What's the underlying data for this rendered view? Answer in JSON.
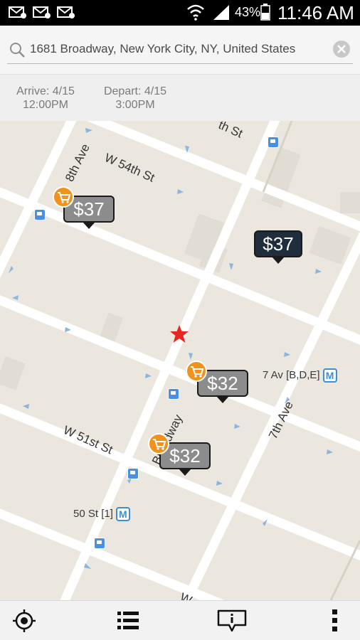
{
  "status_bar": {
    "battery_percent": "43%",
    "time": "11:46 AM",
    "icons": [
      "email-icon",
      "email-icon",
      "email-icon",
      "wifi-icon",
      "signal-icon",
      "battery-icon"
    ]
  },
  "search": {
    "value": "1681 Broadway, New York City, NY, United States",
    "icon": "search-icon",
    "clear_icon": "clear-icon"
  },
  "dates": {
    "arrive_label": "Arrive: 4/15",
    "arrive_time": "12:00PM",
    "depart_label": "Depart: 4/15",
    "depart_time": "3:00PM"
  },
  "map": {
    "streets": {
      "w54": "W 54th St",
      "w51": "W 51st St",
      "eighth": "8th Ave",
      "seventh": "7th Ave",
      "broadway": "Broadway",
      "top_partial": "th St",
      "bottom_partial": "W"
    },
    "stations": {
      "seventh_av": "7 Av [B,D,E]",
      "fifty_st": "50 St [1]",
      "badge": "M"
    },
    "pins": [
      {
        "price": "$37",
        "style": "gray",
        "has_cart": true
      },
      {
        "price": "$37",
        "style": "dark",
        "has_cart": false
      },
      {
        "price": "$32",
        "style": "gray",
        "has_cart": true
      },
      {
        "price": "$32",
        "style": "gray",
        "has_cart": true
      }
    ],
    "destination_icon": "star-icon",
    "colors": {
      "land": "#ebe7df",
      "road": "#ffffff",
      "pin_gray": "#8c8c8c",
      "pin_dark": "#1f2d3d",
      "cart": "#f0931e",
      "star": "#e8251f"
    }
  },
  "bottom_bar": {
    "buttons": [
      "locate-icon",
      "list-icon",
      "info-icon",
      "overflow-menu-icon"
    ]
  }
}
